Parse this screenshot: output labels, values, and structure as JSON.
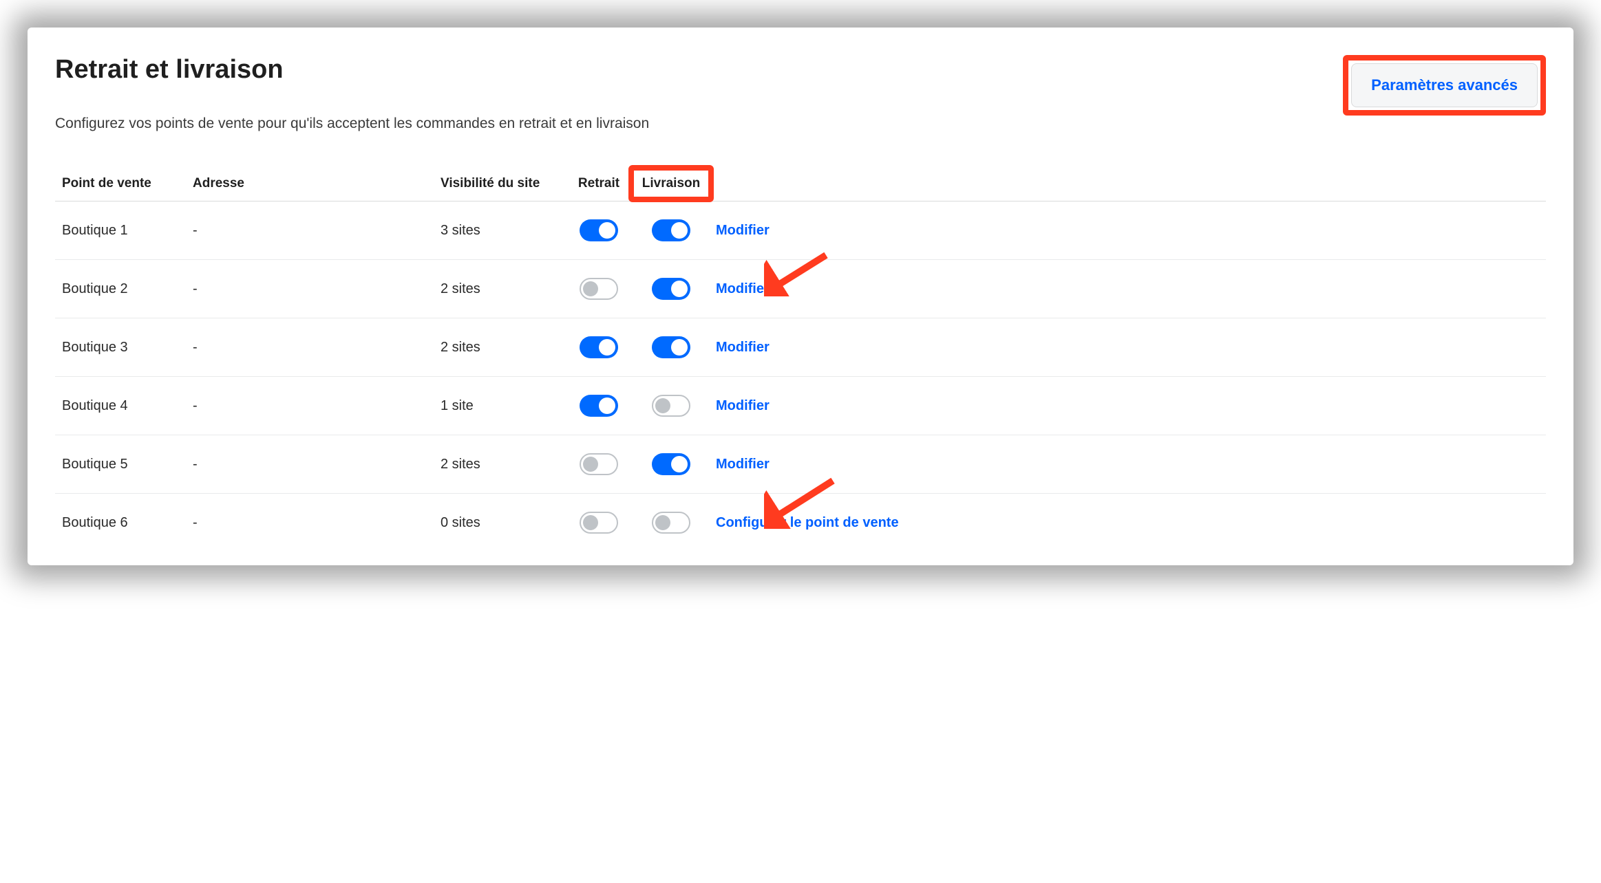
{
  "header": {
    "title": "Retrait et livraison",
    "subtitle": "Configurez vos points de vente pour qu'ils acceptent les commandes en retrait et en livraison",
    "advanced_button": "Paramètres avancés"
  },
  "columns": {
    "pos": "Point de vente",
    "address": "Adresse",
    "visibility": "Visibilité du site",
    "pickup": "Retrait",
    "delivery": "Livraison"
  },
  "rows": [
    {
      "name": "Boutique 1",
      "address": "-",
      "visibility": "3 sites",
      "pickup": true,
      "delivery": true,
      "action": "Modifier"
    },
    {
      "name": "Boutique 2",
      "address": "-",
      "visibility": "2 sites",
      "pickup": false,
      "delivery": true,
      "action": "Modifier"
    },
    {
      "name": "Boutique 3",
      "address": "-",
      "visibility": "2 sites",
      "pickup": true,
      "delivery": true,
      "action": "Modifier"
    },
    {
      "name": "Boutique 4",
      "address": "-",
      "visibility": "1 site",
      "pickup": true,
      "delivery": false,
      "action": "Modifier"
    },
    {
      "name": "Boutique 5",
      "address": "-",
      "visibility": "2 sites",
      "pickup": false,
      "delivery": true,
      "action": "Modifier"
    },
    {
      "name": "Boutique 6",
      "address": "-",
      "visibility": "0 sites",
      "pickup": false,
      "delivery": false,
      "action": "Configurer le point de vente"
    }
  ],
  "annotations": {
    "highlight_advanced_button": true,
    "highlight_delivery_header": true,
    "arrow_to_modifier_row_index": 1,
    "arrow_to_configure_row_index": 5,
    "highlight_color": "#ff3b1f",
    "accent_color": "#0060ff"
  }
}
